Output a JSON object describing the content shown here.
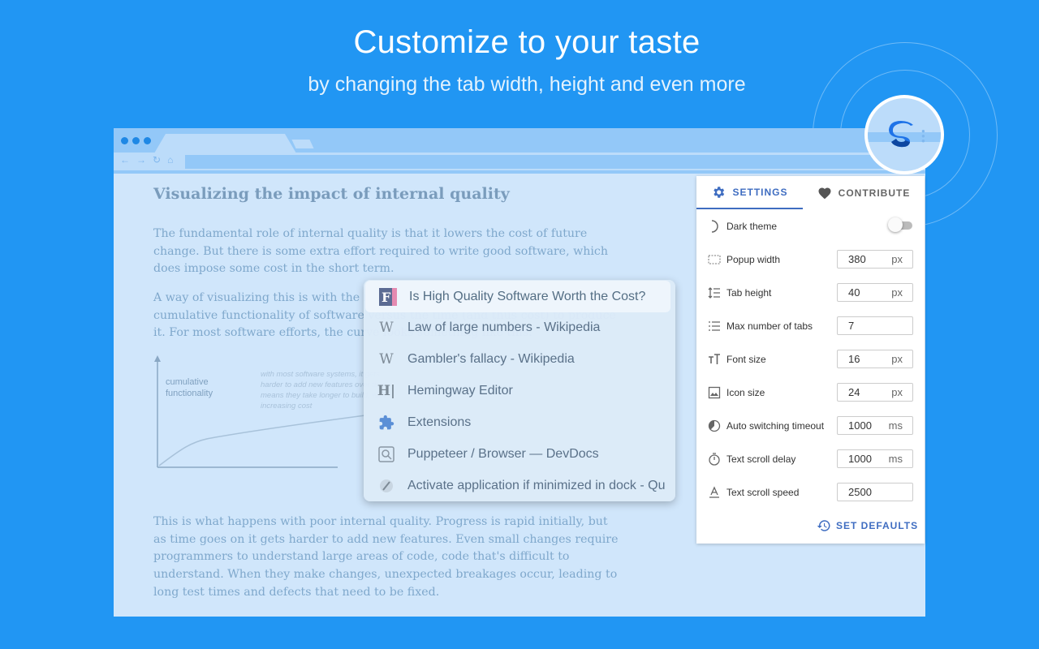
{
  "hero": {
    "title": "Customize to your taste",
    "subtitle": "by changing the tab width, height and even more"
  },
  "article": {
    "title": "Visualizing the impact of internal quality",
    "p1": "The fundamental role of internal quality is that it lowers the cost of future change. But there is some extra effort required to write good software, which does impose some cost in the short term.",
    "p2": "A way of visualizing this is with the following pseudo-graph, where I plot the cumulative functionality of software versus the time (and thus cost) to produce it. For most software efforts, the curve looks something like this.",
    "p3": "This is what happens with poor internal quality. Progress is rapid initially, but as time goes on it gets harder to add new features. Even small changes require programmers to understand large areas of code, code that's difficult to understand. When they make changes, unexpected breakages occur, leading to long test times and defects that need to be fixed.",
    "chart": {
      "ylabel_1": "cumulative",
      "ylabel_2": "functionality",
      "note_1": "with most software systems, it gets",
      "note_2": "harder to add new features over time",
      "note_3": "means they take longer to build, with",
      "note_4": "increasing cost"
    }
  },
  "popup": {
    "tabs": [
      {
        "title": "Is High Quality Software Worth the Cost?",
        "icon": "f-icon"
      },
      {
        "title": "Law of large numbers - Wikipedia",
        "icon": "wikipedia-icon"
      },
      {
        "title": "Gambler's fallacy - Wikipedia",
        "icon": "wikipedia-icon"
      },
      {
        "title": "Hemingway Editor",
        "icon": "hemingway-icon"
      },
      {
        "title": "Extensions",
        "icon": "puzzle-icon"
      },
      {
        "title": "Puppeteer / Browser — DevDocs",
        "icon": "devdocs-icon"
      },
      {
        "title": "Activate application if minimized in dock - Qu",
        "icon": "stackoverflow-icon"
      }
    ]
  },
  "panel": {
    "tab_settings": "SETTINGS",
    "tab_contribute": "CONTRIBUTE",
    "dark_theme": "Dark theme",
    "popup_width": {
      "label": "Popup width",
      "value": "380",
      "unit": "px"
    },
    "tab_height": {
      "label": "Tab height",
      "value": "40",
      "unit": "px"
    },
    "max_tabs": {
      "label": "Max number of tabs",
      "value": "7"
    },
    "font_size": {
      "label": "Font size",
      "value": "16",
      "unit": "px"
    },
    "icon_size": {
      "label": "Icon size",
      "value": "24",
      "unit": "px"
    },
    "auto_switch": {
      "label": "Auto switching timeout",
      "value": "1000",
      "unit": "ms"
    },
    "scroll_delay": {
      "label": "Text scroll delay",
      "value": "1000",
      "unit": "ms"
    },
    "scroll_speed": {
      "label": "Text scroll speed",
      "value": "2500"
    },
    "set_defaults": "SET DEFAULTS",
    "dark_theme_on": false
  },
  "colors": {
    "background": "#2196f3",
    "accent": "#3f6dc1"
  }
}
